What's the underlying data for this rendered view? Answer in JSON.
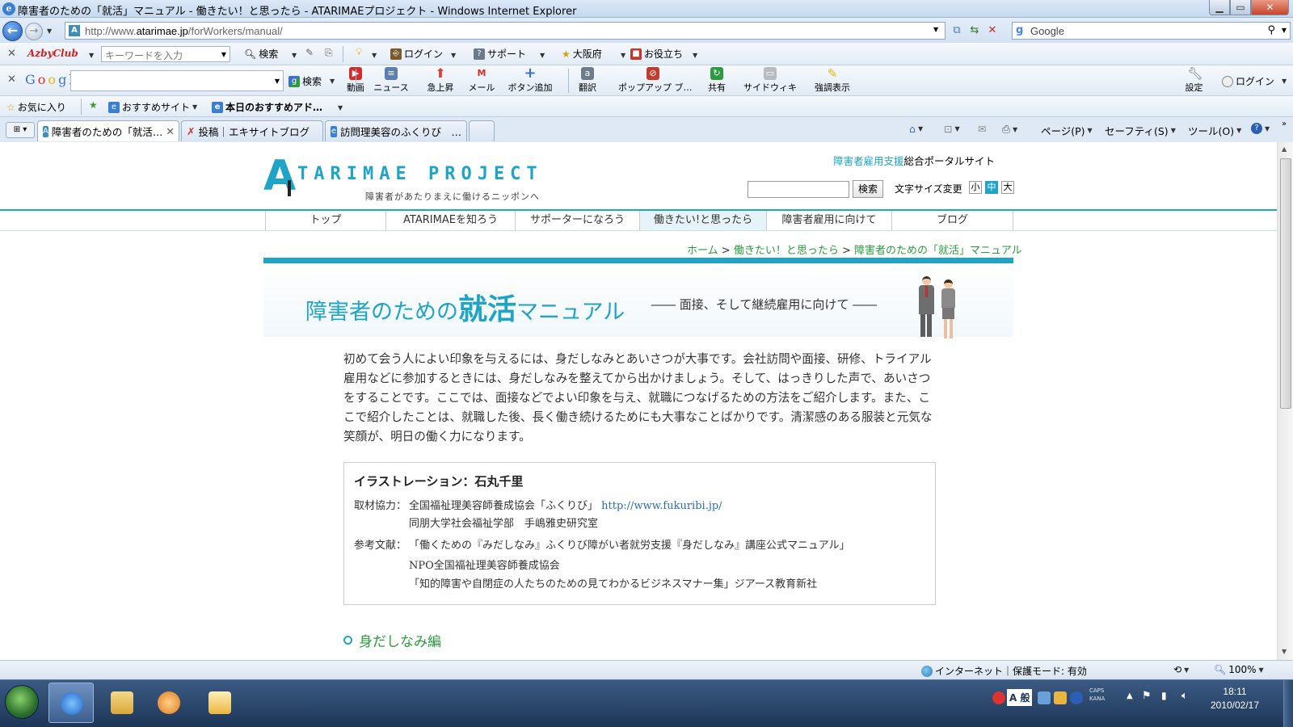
{
  "window": {
    "title": "障害者のための「就活」マニュアル - 働きたい！と思ったら - ATARIMAEプロジェクト - Windows Internet Explorer"
  },
  "address": {
    "url_prefix": "http://www.",
    "url_host": "atarimae.jp",
    "url_path": "/forWorkers/manual/",
    "search_engine": "Google"
  },
  "azby_bar": {
    "logo": "AzbyClub",
    "placeholder": "キーワードを入力",
    "search": "検索",
    "login": "ログイン",
    "support": "サポート",
    "osaka": "大阪府",
    "useful": "お役立ち"
  },
  "google_bar": {
    "logo": "Google",
    "search": "検索",
    "buttons": [
      "動画",
      "ニュース",
      "急上昇",
      "メール",
      "ボタン追加",
      "翻訳",
      "ポップアップ ブ…",
      "共有",
      "サイドウィキ",
      "強調表示"
    ],
    "settings": "設定",
    "login": "ログイン"
  },
  "fav_bar": {
    "favorites": "お気に入り",
    "recommended": "おすすめサイト",
    "today": "本日のおすすめアド…"
  },
  "tabs": [
    {
      "label": "障害者のための「就活…",
      "active": true
    },
    {
      "label": "投稿｜エキサイトブログ",
      "active": false
    },
    {
      "label": "訪問理美容のふくりび　…",
      "active": false
    }
  ],
  "commands": {
    "page": "ページ(P)",
    "safety": "セーフティ(S)",
    "tools": "ツール(O)"
  },
  "site": {
    "logo_letter": "A",
    "logo_name": "TARIMAE PROJECT",
    "logo_sub": "障害者があたりまえに働けるニッポンへ",
    "portal_highlight": "障害者雇用支援",
    "portal_rest": "総合ポータルサイト",
    "search_button": "検索",
    "fontsize_label": "文字サイズ変更",
    "fontsize_options": [
      "小",
      "中",
      "大"
    ],
    "fontsize_selected": "中",
    "nav": [
      "トップ",
      "ATARIMAEを知ろう",
      "サポーターになろう",
      "働きたい!と思ったら",
      "障害者雇用に向けて",
      "ブログ"
    ],
    "nav_current": "働きたい!と思ったら",
    "breadcrumb": [
      "ホーム",
      "働きたい！と思ったら",
      "障害者のための「就活」マニュアル"
    ],
    "breadcrumb_sep": ">"
  },
  "banner": {
    "title_pre": "障害者のための",
    "title_big": "就活",
    "title_post": "マニュアル",
    "subtitle": "―― 面接、そして継続雇用に向けて ――"
  },
  "intro": "初めて会う人によい印象を与えるには、身だしなみとあいさつが大事です。会社訪問や面接、研修、トライアル雇用などに参加するときには、身だしなみを整えてから出かけましょう。そして、はっきりした声で、あいさつをすることです。ここでは、面接などでよい印象を与え、就職につなげるための方法をご紹介します。また、ここで紹介したことは、就職した後、長く働き続けるためにも大事なことばかりです。清潔感のある服装と元気な笑顔が、明日の働く力になります。",
  "credits": {
    "title": "イラストレーション：石丸千里",
    "coop_label": "取材協力：",
    "coop_line1": "全国福祉理美容師養成協会「ふくりび」",
    "coop_url": "http://www.fukuribi.jp/",
    "coop_line2": "同朋大学社会福祉学部　手嶋雅史研究室",
    "ref_label": "参考文献：",
    "ref_line1": "「働くための『みだしなみ』ふくりび障がい者就労支援『身だしなみ』講座公式マニュアル」",
    "ref_line2": "NPO全国福祉理美容師養成協会",
    "ref_line3": "「知的障害や自閉症の人たちのための見てわかるビジネスマナー集」ジアース教育新社"
  },
  "section_title": "身だしなみ編",
  "status": {
    "zone": "インターネット｜保護モード: 有効",
    "zoom": "100%"
  },
  "taskbar": {
    "time": "18:11",
    "date": "2010/02/17",
    "ime": "A 般",
    "caps": "CAPS",
    "kana": "KANA"
  },
  "colors": {
    "brand": "#1fa4c7",
    "link_green": "#2b9c3e"
  }
}
